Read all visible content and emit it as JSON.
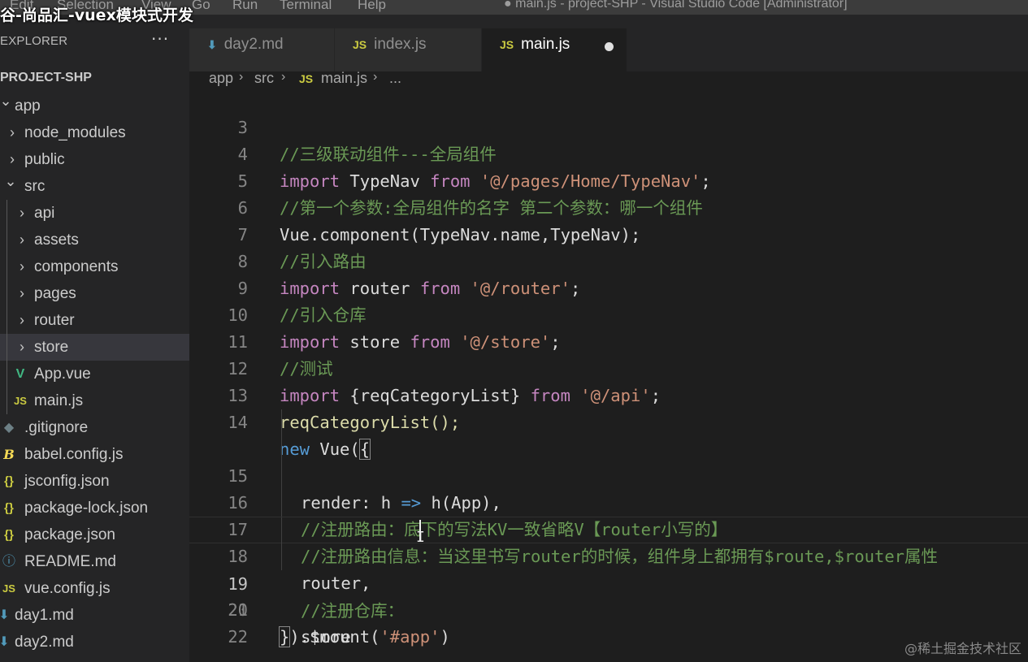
{
  "menu": [
    "Edit",
    "Selection",
    "View",
    "Go",
    "Run",
    "Terminal",
    "Help"
  ],
  "window_title": "● main.js - project-SHP - Visual Studio Code [Administrator]",
  "overlay_title": "谷-尚品汇-vuex模块式开发",
  "sidebar": {
    "header": "EXPLORER",
    "more": "···",
    "project": "PROJECT-SHP",
    "items": [
      {
        "label": "app",
        "icon": "chevron-down",
        "glyph": "⌄"
      },
      {
        "label": "node_modules",
        "icon": "chevron-right",
        "glyph": "›"
      },
      {
        "label": "public",
        "icon": "chevron-right",
        "glyph": "›"
      },
      {
        "label": "src",
        "icon": "chevron-down",
        "glyph": "⌄"
      },
      {
        "label": "api",
        "icon": "chevron-right",
        "glyph": "›"
      },
      {
        "label": "assets",
        "icon": "chevron-right",
        "glyph": "›"
      },
      {
        "label": "components",
        "icon": "chevron-right",
        "glyph": "›"
      },
      {
        "label": "pages",
        "icon": "chevron-right",
        "glyph": "›"
      },
      {
        "label": "router",
        "icon": "chevron-right",
        "glyph": "›"
      },
      {
        "label": "store",
        "icon": "chevron-right",
        "glyph": "›"
      },
      {
        "label": "App.vue",
        "icon": "vue-file",
        "glyph": "V"
      },
      {
        "label": "main.js",
        "icon": "js-file",
        "glyph": "JS"
      },
      {
        "label": ".gitignore",
        "icon": "git-file",
        "glyph": "◆"
      },
      {
        "label": "babel.config.js",
        "icon": "babel-file",
        "glyph": "B"
      },
      {
        "label": "jsconfig.json",
        "icon": "json-file",
        "glyph": "{}"
      },
      {
        "label": "package-lock.json",
        "icon": "json-file",
        "glyph": "{}"
      },
      {
        "label": "package.json",
        "icon": "json-file",
        "glyph": "{}"
      },
      {
        "label": "README.md",
        "icon": "info-file",
        "glyph": "ⓘ"
      },
      {
        "label": "vue.config.js",
        "icon": "js-file",
        "glyph": "JS"
      },
      {
        "label": "day1.md",
        "icon": "markdown-file",
        "glyph": "⬇"
      },
      {
        "label": "day2.md",
        "icon": "markdown-file",
        "glyph": "⬇"
      }
    ]
  },
  "tabs": [
    {
      "label": "day2.md",
      "icon_glyph": "⬇"
    },
    {
      "label": "index.js",
      "icon_glyph": "JS"
    },
    {
      "label": "main.js",
      "icon_glyph": "JS"
    }
  ],
  "breadcrumb": {
    "part1": "app",
    "part2": "src",
    "js_glyph": "JS",
    "part3": "main.js",
    "part4": "...",
    "sep": "›"
  },
  "editor": {
    "line_numbers": [
      "3",
      "4",
      "5",
      "6",
      "7",
      "8",
      "9",
      "10",
      "11",
      "12",
      "13",
      "14",
      "15",
      "16",
      "17",
      "18",
      "19",
      "20",
      "21",
      "22"
    ],
    "current_line": "19",
    "lines": {
      "l3": [
        "//三级联动组件---全局组件"
      ],
      "l4": [
        "import",
        " TypeNav ",
        "from",
        " ",
        "'@/pages/Home/TypeNav'",
        ";"
      ],
      "l5": [
        "//第一个参数:全局组件的名字 第二个参数：哪一个组件"
      ],
      "l6": [
        "Vue.component(TypeNav.name,TypeNav);"
      ],
      "l7": [
        "//引入路由"
      ],
      "l8": [
        "import",
        " router ",
        "from",
        " ",
        "'@/router'",
        ";"
      ],
      "l9": [
        "//引入仓库"
      ],
      "l10": [
        "import",
        " store ",
        "from",
        " ",
        "'@/store'",
        ";"
      ],
      "l11": [
        "//测试"
      ],
      "l12": [
        "import",
        " {reqCategoryList} ",
        "from",
        " ",
        "'@/api'",
        ";"
      ],
      "l13": [
        "reqCategoryList();"
      ],
      "l14": [
        "new",
        " Vue(",
        "{"
      ],
      "l15": [
        "render",
        ": h ",
        "=>",
        " h(App),"
      ],
      "l16": [
        "//注册路由：底下的写法KV一致省略V【router小写的】"
      ],
      "l17": [
        "//注册路由信息：当这里书写router的时候，组件身上都拥有$route,$router属性"
      ],
      "l18": [
        "router,"
      ],
      "l19": [
        "//注册仓库："
      ],
      "l20": [
        "store"
      ],
      "l21": [
        "}",
        ").$mount(",
        "'#app'",
        ")"
      ]
    }
  },
  "watermark": "@稀土掘金技术社区",
  "colors": {
    "keyword": "#569cd6",
    "string": "#ce9178",
    "comment": "#6a9955",
    "background": "#1e1e1e",
    "sidebar": "#252526"
  }
}
